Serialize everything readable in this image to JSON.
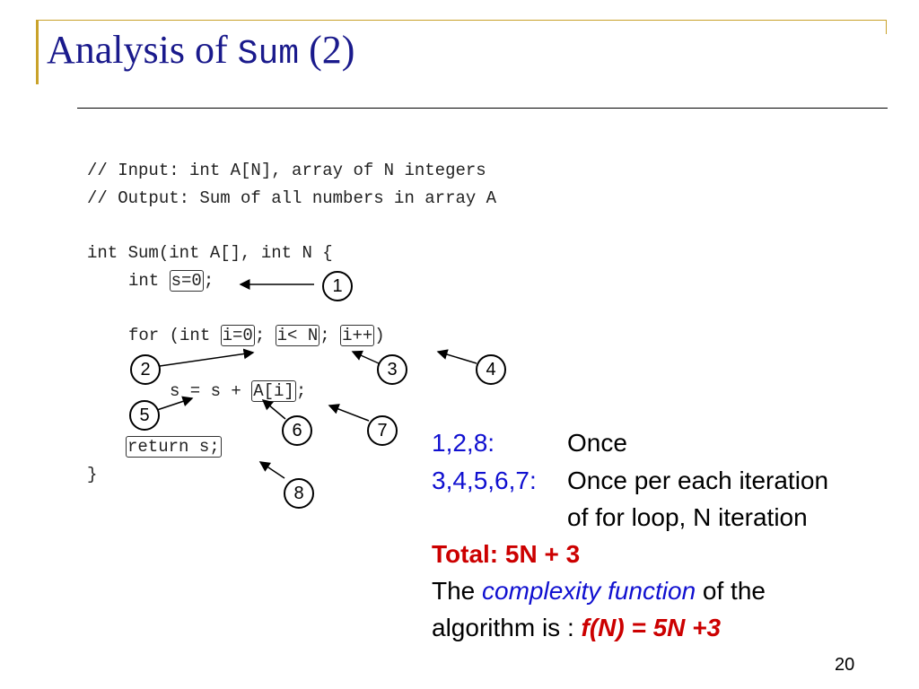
{
  "title": {
    "prefix": "Analysis of ",
    "mono": "Sum",
    "suffix": " (2)"
  },
  "code": {
    "line1": "// Input: int A[N], array of N integers",
    "line2": "// Output: Sum of all numbers in array A",
    "line3": "int Sum(int A[], int N {",
    "line4_pre": "int ",
    "line4_box": "s=0",
    "line4_post": ";",
    "line5_pre": "for (int ",
    "line5_box1": "i=0",
    "line5_mid1": "; ",
    "line5_box2": "i< N",
    "line5_mid2": "; ",
    "line5_box3": "i++",
    "line5_post": ")",
    "line6_pre": "s = s + ",
    "line6_box": "A[i]",
    "line6_post": ";",
    "line7_box": "return s;",
    "line8": "}"
  },
  "markers": [
    "1",
    "2",
    "3",
    "4",
    "5",
    "6",
    "7",
    "8"
  ],
  "notes": {
    "row1_label": "1,2,8:",
    "row1_value": "Once",
    "row2_label": "3,4,5,6,7:",
    "row2_value": "Once per each iteration",
    "row3_value": "of for loop, N iteration",
    "total": "Total: 5N + 3",
    "complexity_pre": "The ",
    "complexity_term": "complexity function",
    "complexity_post": " of the",
    "algo_pre": "algorithm is : ",
    "algo_formula": "f(N) = 5N +3"
  },
  "page_number": "20",
  "colors": {
    "title": "#1a1a8c",
    "accent": "#c9a22a",
    "blue": "#1010d0",
    "red": "#cc0000"
  }
}
